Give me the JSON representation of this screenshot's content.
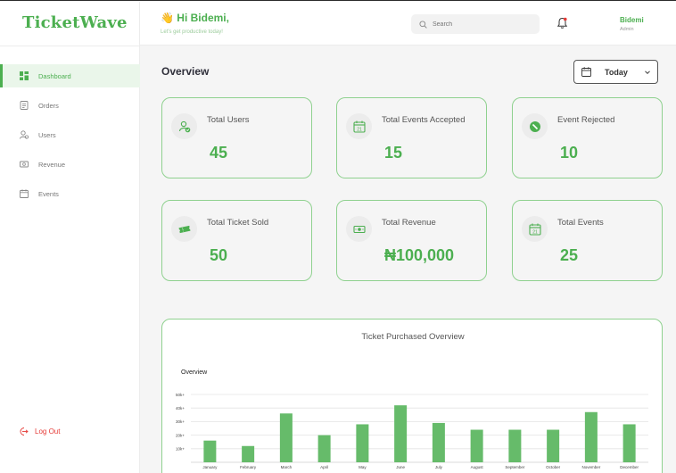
{
  "app": {
    "logo": "TicketWave"
  },
  "header": {
    "greeting": "👋 Hi Bidemi,",
    "subtitle": "Let's get productive today!",
    "search_placeholder": "Search",
    "user_name": "Bidemi",
    "user_role": "Admin"
  },
  "sidebar": {
    "items": [
      {
        "label": "Dashboard",
        "icon": "dashboard-icon",
        "active": true
      },
      {
        "label": "Orders",
        "icon": "orders-icon"
      },
      {
        "label": "Users",
        "icon": "users-icon"
      },
      {
        "label": "Revenue",
        "icon": "revenue-icon"
      },
      {
        "label": "Events",
        "icon": "events-icon"
      }
    ],
    "logout_label": "Log  Out"
  },
  "main": {
    "title": "Overview",
    "period": "Today",
    "cards": [
      {
        "label": "Total Users",
        "value": "45",
        "icon": "user-check-icon"
      },
      {
        "label": "Total Events Accepted",
        "value": "15",
        "icon": "calendar-icon"
      },
      {
        "label": "Event Rejected",
        "value": "10",
        "icon": "reject-icon"
      },
      {
        "label": "Total Ticket Sold",
        "value": "50",
        "icon": "ticket-icon"
      },
      {
        "label": "Total Revenue",
        "value": "₦100,000",
        "icon": "cash-icon"
      },
      {
        "label": "Total Events",
        "value": "25",
        "icon": "calendar-icon"
      }
    ]
  },
  "colors": {
    "accent": "#4caf50",
    "bar": "#66bb6a",
    "danger": "#e53935"
  },
  "chart_data": {
    "type": "bar",
    "title": "Ticket Purchased Overview",
    "subtitle": "Overview",
    "categories": [
      "January",
      "February",
      "March",
      "April",
      "May",
      "June",
      "July",
      "August",
      "September",
      "October",
      "November",
      "December"
    ],
    "values": [
      16,
      12,
      36,
      20,
      28,
      42,
      29,
      24,
      24,
      24,
      37,
      28
    ],
    "ytick_labels": [
      "10k+",
      "20k+",
      "30k+",
      "40k+",
      "50k+"
    ],
    "yticks": [
      10,
      20,
      30,
      40,
      50
    ],
    "ylim": [
      0,
      50
    ],
    "grid": true
  }
}
